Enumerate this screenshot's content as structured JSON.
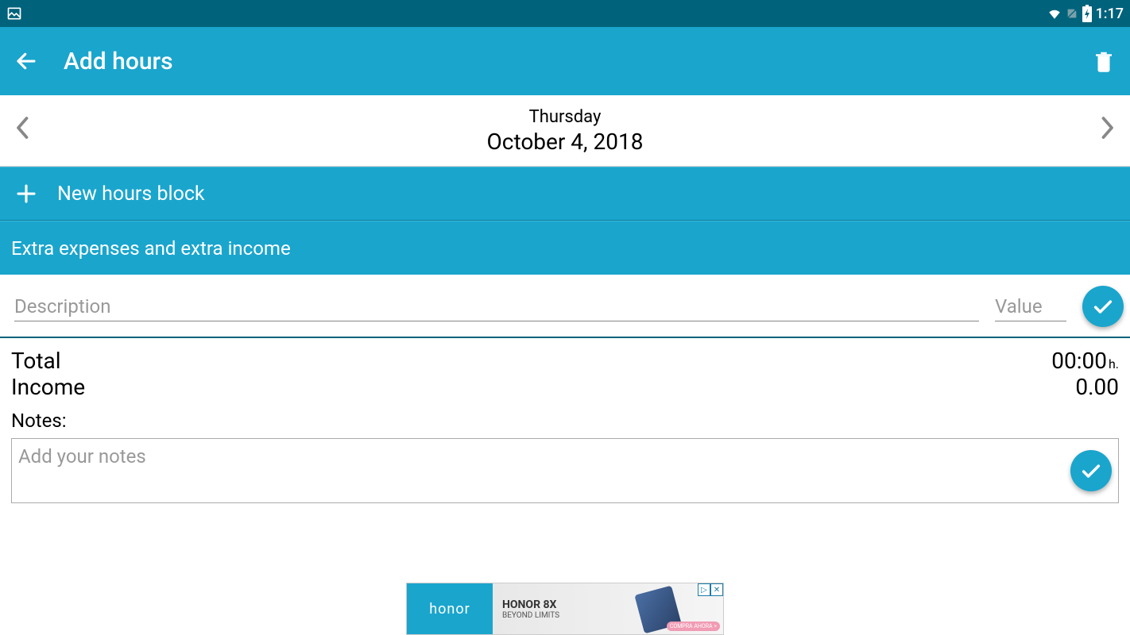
{
  "status_bar": {
    "time": "1:17"
  },
  "app_bar": {
    "title": "Add hours"
  },
  "date_nav": {
    "day": "Thursday",
    "date": "October 4, 2018"
  },
  "new_block": {
    "label": "New hours block"
  },
  "extras": {
    "header": "Extra expenses and extra income",
    "description_placeholder": "Description",
    "value_placeholder": "Value"
  },
  "totals": {
    "total_label": "Total",
    "total_value": "00:00",
    "total_unit": "h.",
    "income_label": "Income",
    "income_value": "0.00"
  },
  "notes": {
    "label": "Notes:",
    "placeholder": "Add your notes"
  },
  "ad": {
    "brand": "honor",
    "title": "HONOR 8X",
    "subtitle": "BEYOND LIMITS",
    "cta": "COMPRA AHORA >"
  }
}
